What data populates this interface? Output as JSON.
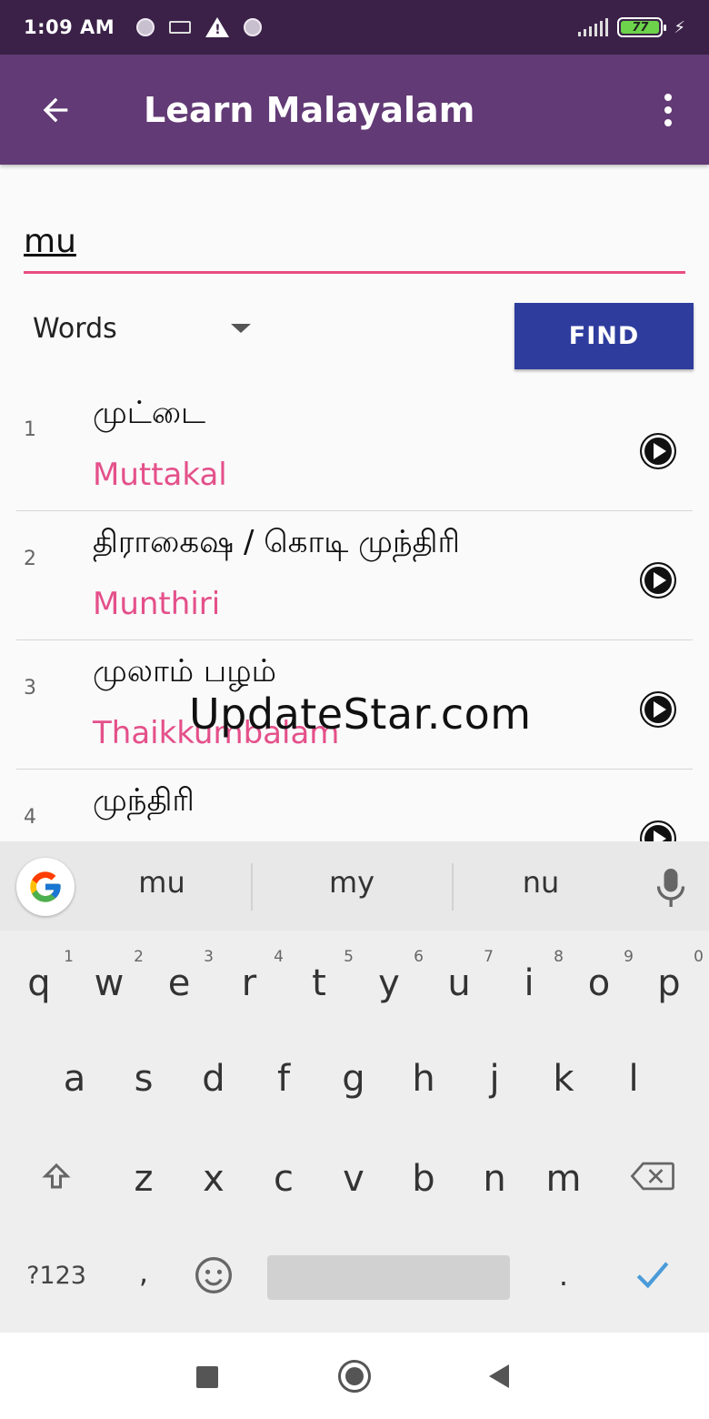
{
  "status_bar": {
    "time": "1:09 AM",
    "battery": "77",
    "charging": "⚡"
  },
  "app_bar": {
    "title": "Learn Malayalam"
  },
  "search": {
    "value": "mu"
  },
  "filter": {
    "selected": "Words"
  },
  "find_button": {
    "label": "FIND"
  },
  "results": [
    {
      "num": "1",
      "native": "முட்டை",
      "roman": "Muttakal"
    },
    {
      "num": "2",
      "native": "திராகைஷ / கொடி முந்திரி",
      "roman": "Munthiri"
    },
    {
      "num": "3",
      "native": "முலாம் பழம்",
      "roman": "Thaikkumbalam"
    },
    {
      "num": "4",
      "native": "முந்திரி",
      "roman": ""
    }
  ],
  "watermark": "UpdateStar.com",
  "keyboard": {
    "suggestions": [
      "mu",
      "my",
      "nu"
    ],
    "row1": [
      "q",
      "w",
      "e",
      "r",
      "t",
      "y",
      "u",
      "i",
      "o",
      "p"
    ],
    "row1_digits": [
      "1",
      "2",
      "3",
      "4",
      "5",
      "6",
      "7",
      "8",
      "9",
      "0"
    ],
    "row2": [
      "a",
      "s",
      "d",
      "f",
      "g",
      "h",
      "j",
      "k",
      "l"
    ],
    "row3": [
      "z",
      "x",
      "c",
      "v",
      "b",
      "n",
      "m"
    ],
    "symbols_key": "?123",
    "comma_key": ",",
    "period_key": "."
  },
  "colors": {
    "status_bar": "#3b2148",
    "app_bar": "#623a75",
    "accent_pink": "#e4508a",
    "find_button": "#2e3c9e"
  }
}
